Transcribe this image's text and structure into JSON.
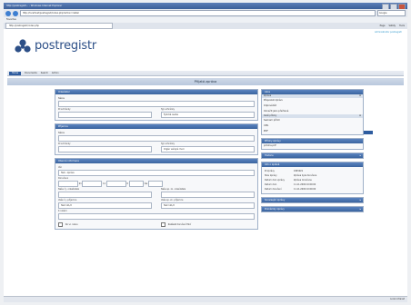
{
  "browser": {
    "title": "http://postregistr... - Windows Internet Explorer",
    "address": "http://localhost/postregistr/index.php?action=detail",
    "search_placeholder": "Google",
    "favorites_label": "Favorites",
    "tab_label": "http://postregistr/index.php",
    "tools": [
      "Page",
      "Safety",
      "Tools"
    ],
    "status_text": "Local intranet"
  },
  "app": {
    "logo_text": "postregistr",
    "user_line": "Administrator postregistr",
    "brand_color": "#2c4f87",
    "accent_color": "#3a649f"
  },
  "menu": {
    "items": [
      "Home",
      "Documents",
      "Search",
      "Admin"
    ],
    "right_button": "Logout"
  },
  "page_title": "Přijatá zpráva",
  "sender": {
    "title": "Odesílatel",
    "name_label": "Název",
    "name_value": "",
    "id_label": "ID schránky",
    "type_label": "Typ schránky",
    "type_value": "Fyzická osoba"
  },
  "recipient": {
    "title": "Příjemce",
    "name_label": "Název",
    "name_value": "",
    "id_label": "ID schránky",
    "type_label": "Typ schránky",
    "type_value": "Orgán veřejné moci"
  },
  "details": {
    "title": "Obecné informace",
    "subject_label": "Věc",
    "subject_value": "Test - zpráva",
    "delivered_label": "Doručeno",
    "d1": "21",
    "d2": "11",
    "d3": "0",
    "time_label": "čas",
    "time_suffix": "",
    "sender_ref_label": "Naše č.j. odesílatele",
    "sender_sig_label": "Naše sp. zn. odesílatele",
    "recipient_ref_label": "Vaše č.j. příjemce",
    "recipient_ref_value": "Test 111/2",
    "recipient_sig_label": "Vaše sp. zn. příjemce",
    "recipient_sig_value": "Test 111/2",
    "to_hands_label": "K rukám",
    "check1_label": "Do vl. rukou",
    "check2_label": "Zakázat doručení fikcí"
  },
  "sidebar": {
    "actions_title": "Akce",
    "actions_subtitle": "Zpráva",
    "actions": [
      "Přeposlat zprávu",
      "Odpovědět",
      "Označit jako přečtené"
    ],
    "attachments_subtitle": "Další přílohy",
    "attachments": [
      "Seznam příloh",
      "XML",
      "PDF"
    ],
    "files_title": "Přílohy zprávy",
    "files": [
      "priloha.pdf"
    ],
    "history_title": "Historie",
    "info_title": "Info o zprávě",
    "info": [
      {
        "k": "ID zprávy",
        "v": "1845921"
      },
      {
        "k": "Stav zprávy",
        "v": "Zpráva byla doručena"
      },
      {
        "k": "Datum dod. zprávy",
        "v": "Zpráva doručena"
      },
      {
        "k": "Datum dod.",
        "v": "11.11.2009 10:00:00"
      },
      {
        "k": "Datum doručení",
        "v": "11.11.2009 10:00:00"
      }
    ],
    "more_title": "Související zprávy",
    "notes_title": "Poznámky zprávy"
  }
}
